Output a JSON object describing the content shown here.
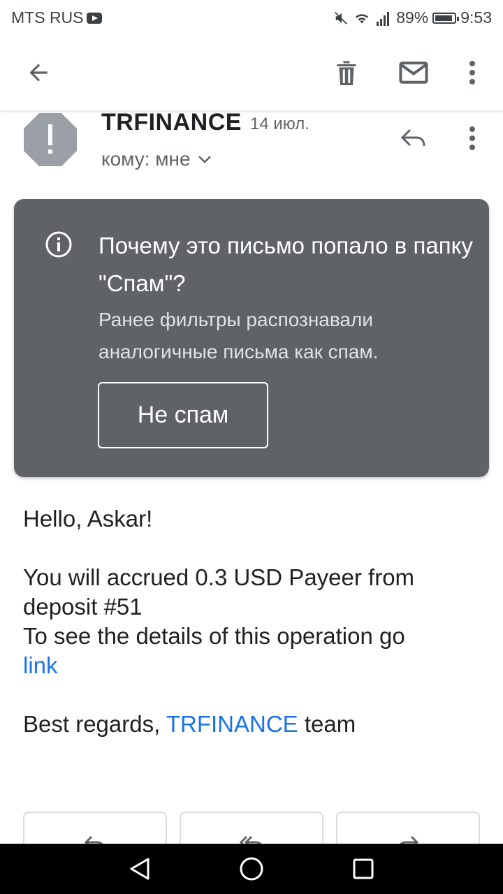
{
  "status_bar": {
    "carrier": "MTS RUS",
    "battery": "89%",
    "time": "9:53"
  },
  "toolbar": {
    "back_icon": "arrow-left-icon",
    "delete_icon": "trash-icon",
    "mail_icon": "envelope-icon",
    "more_icon": "more-vert-icon"
  },
  "header": {
    "sender": "TRFINANCE",
    "date": "14 июл.",
    "to": "кому: мне"
  },
  "spam_card": {
    "title": "Почему это письмо попало в папку \"Спам\"?",
    "description": "Ранее фильтры распознавали аналогичные письма как спам.",
    "button": "Не спам"
  },
  "body": {
    "greeting": "Hello, Askar!",
    "line1": "You will accrued 0.3 USD Payeer from deposit #51",
    "line2": "To see the details of this operation go",
    "link": "link",
    "regards_prefix": "Best regards,",
    "regards_brand": "TRFINANCE",
    "regards_suffix": "team"
  },
  "colors": {
    "card_bg": "#5f6368",
    "link": "#1a73e8"
  }
}
